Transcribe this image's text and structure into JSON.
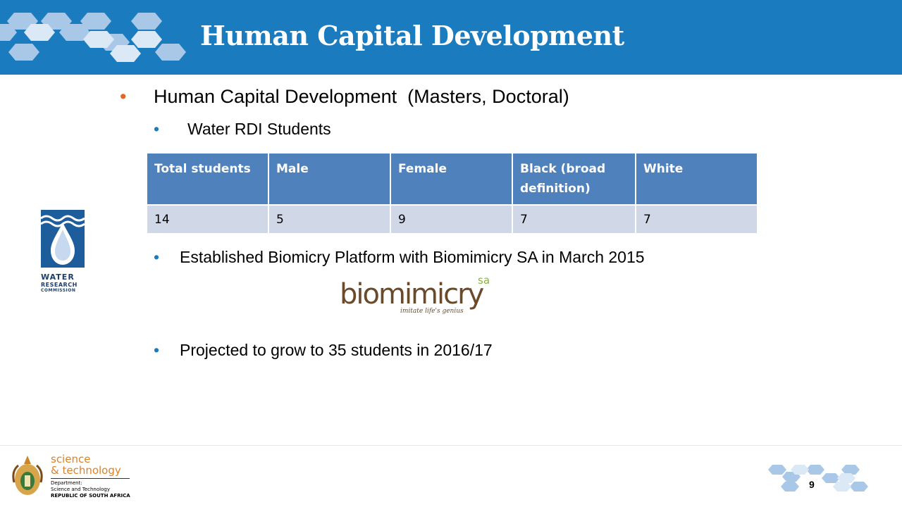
{
  "slide": {
    "title": "Human Capital Development",
    "page_number": "9",
    "bullets": {
      "main": "Human Capital Development  (Masters, Doctoral)",
      "sub": "Water RDI Students",
      "established": "Established Biomicry Platform with Biomimicry SA in March 2015",
      "projected": "Projected to grow to 35 students in 2016/17"
    }
  },
  "table": {
    "headers": [
      "Total students",
      "Male",
      "Female",
      "Black (broad definition)",
      "White"
    ],
    "rows": [
      [
        "14",
        "5",
        "9",
        "7",
        "7"
      ]
    ]
  },
  "logos": {
    "wrc": {
      "line1": "WATER",
      "line2": "RESEARCH",
      "line3": "COMMISSION"
    },
    "biomimicry": {
      "word": "biomimicry",
      "suffix": "sa",
      "tagline": "imitate life's genius"
    },
    "dst": {
      "line1": "science",
      "line2": "& technology",
      "line3": "Department:",
      "line4": "Science and Technology",
      "line5": "REPUBLIC OF SOUTH AFRICA"
    }
  },
  "colors": {
    "header_blue": "#1a7cbf",
    "bullet_orange": "#e2661e",
    "table_header": "#4f81bd",
    "table_row": "#d0d8e8"
  }
}
